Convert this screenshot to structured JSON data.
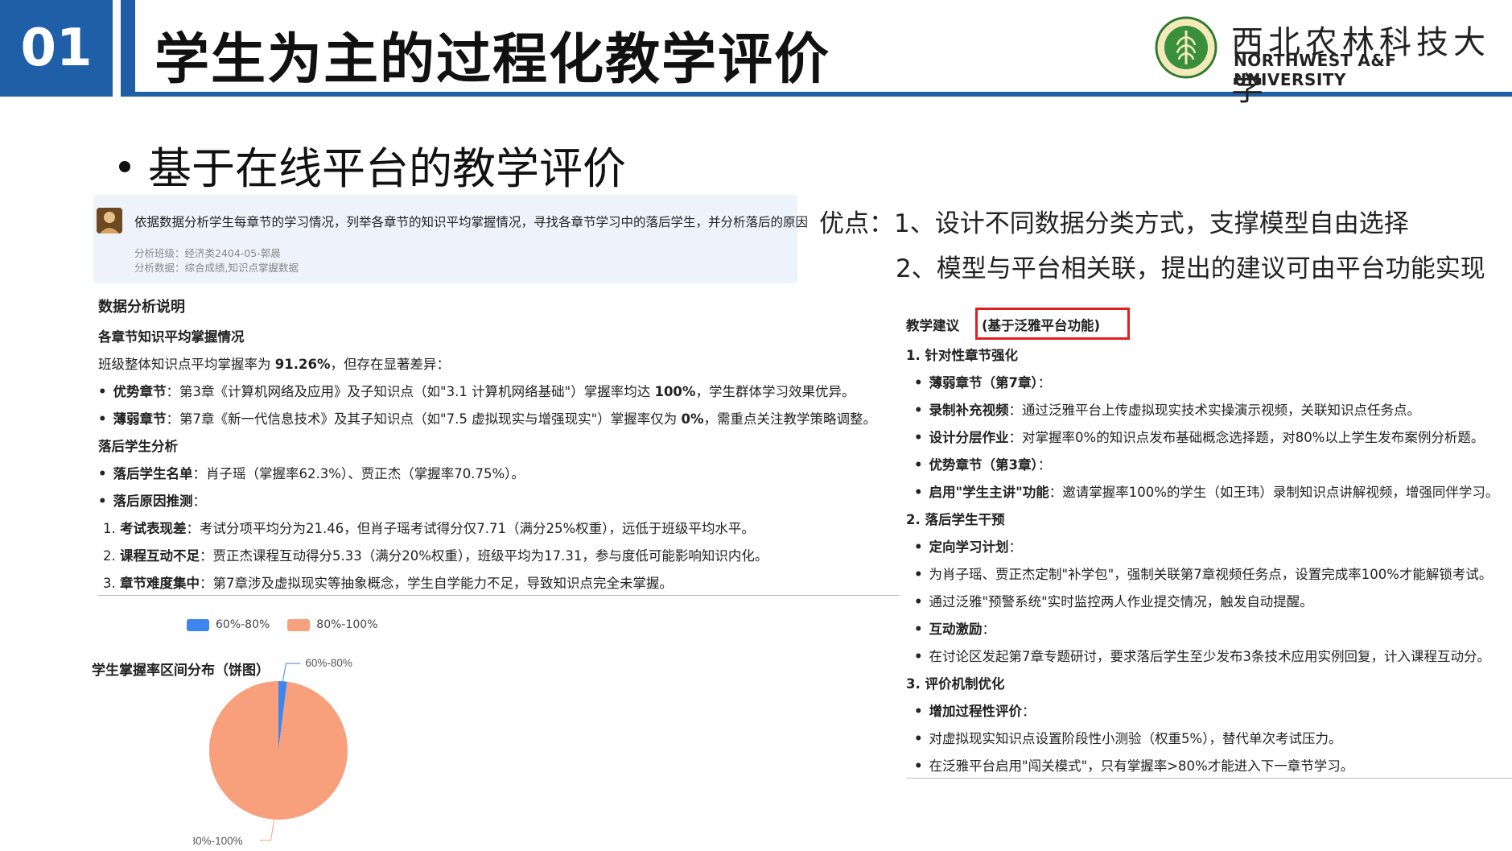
{
  "header": {
    "number": "01",
    "title": "学生为主的过程化教学评价",
    "university_cn": "西北农林科技大学",
    "university_en": "NORTHWEST A&F UNIVERSITY"
  },
  "subtitle": "基于在线平台的教学评价",
  "query": {
    "text": "依据数据分析学生每章节的学习情况，列举各章节的知识平均掌握情况，寻找各章节学习中的落后学生，并分析落后的原因",
    "class_line": "分析班级：经济类2404-05-郭晨",
    "data_line": "分析数据：综合成绩,知识点掌握数据"
  },
  "analysis": {
    "heading": "数据分析说明",
    "sub1": "各章节知识平均掌握情况",
    "overall_pre": "班级整体知识点平均掌握率为 ",
    "overall_val": "91.26%",
    "overall_post": "，但存在显著差异：",
    "strong_label": "优势章节",
    "strong_text": "：第3章《计算机网络及应用》及子知识点（如\"3.1 计算机网络基础\"）掌握率均达 ",
    "strong_val": "100%",
    "strong_post": "，学生群体学习效果优异。",
    "weak_label": "薄弱章节",
    "weak_text": "：第7章《新一代信息技术》及其子知识点（如\"7.5 虚拟现实与增强现实\"）掌握率仅为 ",
    "weak_val": "0%",
    "weak_post": "，需重点关注教学策略调整。",
    "sub2": "落后学生分析",
    "list_label": "落后学生名单",
    "list_text": "：肖子瑶（掌握率62.3%）、贾正杰（掌握率70.75%）。",
    "reason_label": "落后原因推测",
    "reason_colon": "：",
    "reasons": [
      {
        "num": "1.",
        "label": "考试表现差",
        "text": "：考试分项平均分为21.46，但肖子瑶考试得分仅7.71（满分25%权重），远低于班级平均水平。"
      },
      {
        "num": "2.",
        "label": "课程互动不足",
        "text": "：贾正杰课程互动得分5.33（满分20%权重），班级平均为17.31，参与度低可能影响知识内化。"
      },
      {
        "num": "3.",
        "label": "章节难度集中",
        "text": "：第7章涉及虚拟现实等抽象概念，学生自学能力不足，导致知识点完全未掌握。"
      }
    ]
  },
  "chart_data": {
    "type": "pie",
    "title": "学生掌握率区间分布（饼图）",
    "categories": [
      "60%-80%",
      "80%-100%"
    ],
    "values": [
      2,
      98
    ],
    "colors": [
      "#3d86f0",
      "#f8a07c"
    ],
    "legend": [
      "60%-80%",
      "80%-100%"
    ],
    "legend_position": "top"
  },
  "advantages": {
    "label": "优点：",
    "items": [
      "1、设计不同数据分类方式，支撑模型自由选择",
      "2、模型与平台相关联，提出的建议可由平台功能实现"
    ]
  },
  "suggestions": {
    "heading": "教学建议",
    "highlight": "(基于泛雅平台功能)",
    "s1": "1. 针对性章节强化",
    "weak_ch": "薄弱章节（第7章）",
    "weak_ch_colon": "：",
    "video_label": "录制补充视频",
    "video_text": "：通过泛雅平台上传虚拟现实技术实操演示视频，关联知识点任务点。",
    "layer_label": "设计分层作业",
    "layer_text": "：对掌握率0%的知识点发布基础概念选择题，对80%以上学生发布案例分析题。",
    "strong_ch": "优势章节（第3章）",
    "strong_ch_colon": "：",
    "lead_label": "启用\"学生主讲\"功能",
    "lead_text": "：邀请掌握率100%的学生（如王玮）录制知识点讲解视频，增强同伴学习。",
    "s2": "2. 落后学生干预",
    "plan_label": "定向学习计划",
    "plan_colon": "：",
    "plan_1": "为肖子瑶、贾正杰定制\"补学包\"，强制关联第7章视频任务点，设置完成率100%才能解锁考试。",
    "plan_2": "通过泛雅\"预警系统\"实时监控两人作业提交情况，触发自动提醒。",
    "inter_label": "互动激励",
    "inter_colon": "：",
    "inter_1": "在讨论区发起第7章专题研讨，要求落后学生至少发布3条技术应用实例回复，计入课程互动分。",
    "s3": "3. 评价机制优化",
    "eval_label": "增加过程性评价",
    "eval_colon": "：",
    "eval_1": "对虚拟现实知识点设置阶段性小测验（权重5%），替代单次考试压力。",
    "eval_2": "在泛雅平台启用\"闯关模式\"，只有掌握率>80%才能进入下一章节学习。"
  }
}
